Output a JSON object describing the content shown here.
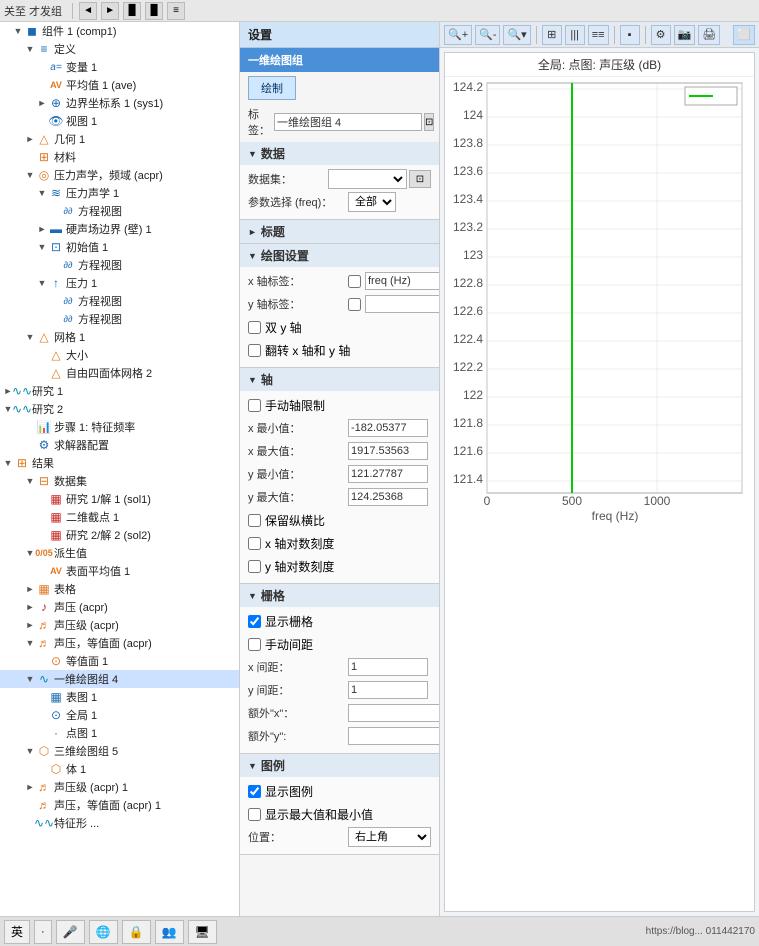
{
  "toolbar": {
    "label": "关至 才发组",
    "buttons": [
      "◄",
      "►",
      "▐▌",
      "▐▌",
      "≡"
    ]
  },
  "left_panel": {
    "tree_items": [
      {
        "id": "comp1",
        "label": "组件 1 (comp1)",
        "indent": 0,
        "arrow": "▼",
        "icon": "cube",
        "icon_color": "blue"
      },
      {
        "id": "defs",
        "label": "定义",
        "indent": 1,
        "arrow": "▼",
        "icon": "list",
        "icon_color": "blue"
      },
      {
        "id": "var1",
        "label": "变量 1",
        "indent": 2,
        "arrow": "",
        "icon": "a",
        "icon_color": "blue"
      },
      {
        "id": "ave",
        "label": "平均值 1 (ave)",
        "indent": 2,
        "arrow": "",
        "icon": "av",
        "icon_color": "orange"
      },
      {
        "id": "sys1",
        "label": "边界坐标系 1 (sys1)",
        "indent": 2,
        "arrow": "►",
        "icon": "axis",
        "icon_color": "blue"
      },
      {
        "id": "view1",
        "label": "视图 1",
        "indent": 2,
        "arrow": "",
        "icon": "eye",
        "icon_color": "blue"
      },
      {
        "id": "geo1",
        "label": "几何 1",
        "indent": 1,
        "arrow": "►",
        "icon": "triangle",
        "icon_color": "orange"
      },
      {
        "id": "mat",
        "label": "材料",
        "indent": 1,
        "arrow": "",
        "icon": "grid",
        "icon_color": "orange"
      },
      {
        "id": "acpr",
        "label": "压力声学，频域 (acpr)",
        "indent": 1,
        "arrow": "▼",
        "icon": "circle",
        "icon_color": "orange"
      },
      {
        "id": "pa1",
        "label": "压力声学 1",
        "indent": 2,
        "arrow": "▼",
        "icon": "wave",
        "icon_color": "blue"
      },
      {
        "id": "eqview1",
        "label": "方程视图",
        "indent": 3,
        "arrow": "",
        "icon": "eq",
        "icon_color": "blue"
      },
      {
        "id": "hb1",
        "label": "硬声场边界 (壁) 1",
        "indent": 2,
        "arrow": "►",
        "icon": "wall",
        "icon_color": "blue"
      },
      {
        "id": "init1",
        "label": "初始值 1",
        "indent": 2,
        "arrow": "▼",
        "icon": "init",
        "icon_color": "blue"
      },
      {
        "id": "eqview2",
        "label": "方程视图",
        "indent": 3,
        "arrow": "",
        "icon": "eq",
        "icon_color": "blue"
      },
      {
        "id": "p1",
        "label": "压力 1",
        "indent": 2,
        "arrow": "▼",
        "icon": "pressure",
        "icon_color": "blue"
      },
      {
        "id": "eqview3",
        "label": "方程视图",
        "indent": 3,
        "arrow": "",
        "icon": "eq",
        "icon_color": "blue"
      },
      {
        "id": "eqview4",
        "label": "方程视图",
        "indent": 3,
        "arrow": "",
        "icon": "eq",
        "icon_color": "blue"
      },
      {
        "id": "mesh1",
        "label": "网格 1",
        "indent": 1,
        "arrow": "▼",
        "icon": "mesh",
        "icon_color": "orange"
      },
      {
        "id": "size1",
        "label": "大小",
        "indent": 2,
        "arrow": "",
        "icon": "mesh-size",
        "icon_color": "orange"
      },
      {
        "id": "ftet2",
        "label": "自由四面体网格 2",
        "indent": 2,
        "arrow": "",
        "icon": "ftet",
        "icon_color": "orange"
      },
      {
        "id": "study1",
        "label": "研究 1",
        "indent": 0,
        "arrow": "►",
        "icon": "study",
        "icon_color": "teal"
      },
      {
        "id": "study2",
        "label": "研究 2",
        "indent": 0,
        "arrow": "▼",
        "icon": "study",
        "icon_color": "teal"
      },
      {
        "id": "step1",
        "label": "步骤 1: 特征频率",
        "indent": 1,
        "arrow": "",
        "icon": "chart-bar",
        "icon_color": "blue"
      },
      {
        "id": "solver1",
        "label": "求解器配置",
        "indent": 1,
        "arrow": "",
        "icon": "solver",
        "icon_color": "blue"
      },
      {
        "id": "results",
        "label": "结果",
        "indent": 0,
        "arrow": "▼",
        "icon": "results",
        "icon_color": "orange"
      },
      {
        "id": "datasets",
        "label": "数据集",
        "indent": 1,
        "arrow": "▼",
        "icon": "dataset",
        "icon_color": "orange"
      },
      {
        "id": "sol1",
        "label": "研究 1/解 1 (sol1)",
        "indent": 2,
        "arrow": "",
        "icon": "sol",
        "icon_color": "red"
      },
      {
        "id": "pts2d",
        "label": "二维截点 1",
        "indent": 2,
        "arrow": "",
        "icon": "pts",
        "icon_color": "red"
      },
      {
        "id": "sol2",
        "label": "研究 2/解 2 (sol2)",
        "indent": 2,
        "arrow": "",
        "icon": "sol",
        "icon_color": "red"
      },
      {
        "id": "derived",
        "label": "派生值",
        "indent": 1,
        "arrow": "▼",
        "icon": "derived",
        "icon_color": "orange"
      },
      {
        "id": "surfavg1",
        "label": "表面平均值 1",
        "indent": 2,
        "arrow": "",
        "icon": "av",
        "icon_color": "orange"
      },
      {
        "id": "tables",
        "label": "表格",
        "indent": 1,
        "arrow": "►",
        "icon": "table",
        "icon_color": "orange"
      },
      {
        "id": "sound",
        "label": "声压 (acpr)",
        "indent": 1,
        "arrow": "►",
        "icon": "sound",
        "icon_color": "red"
      },
      {
        "id": "spl",
        "label": "声压级 (acpr)",
        "indent": 1,
        "arrow": "►",
        "icon": "spl",
        "icon_color": "orange"
      },
      {
        "id": "p_iso",
        "label": "声压，等值面 (acpr)",
        "indent": 1,
        "arrow": "▼",
        "icon": "iso",
        "icon_color": "orange"
      },
      {
        "id": "iso1",
        "label": "等值面 1",
        "indent": 2,
        "arrow": "",
        "icon": "iso-item",
        "icon_color": "orange"
      },
      {
        "id": "plot1d_4",
        "label": "一维绘图组 4",
        "indent": 1,
        "arrow": "▼",
        "icon": "plot1d",
        "icon_color": "teal",
        "selected": true
      },
      {
        "id": "table1",
        "label": "表图 1",
        "indent": 2,
        "arrow": "",
        "icon": "table-chart",
        "icon_color": "blue"
      },
      {
        "id": "global1",
        "label": "全局 1",
        "indent": 2,
        "arrow": "",
        "icon": "global",
        "icon_color": "blue"
      },
      {
        "id": "point1",
        "label": "点图 1",
        "indent": 2,
        "arrow": "",
        "icon": "point",
        "icon_color": "blue"
      },
      {
        "id": "plot3d_5",
        "label": "三维绘图组 5",
        "indent": 1,
        "arrow": "▼",
        "icon": "plot3d",
        "icon_color": "orange"
      },
      {
        "id": "body1",
        "label": "体 1",
        "indent": 2,
        "arrow": "",
        "icon": "body",
        "icon_color": "orange"
      },
      {
        "id": "spl2",
        "label": "声压级 (acpr) 1",
        "indent": 1,
        "arrow": "►",
        "icon": "spl",
        "icon_color": "orange"
      },
      {
        "id": "p_iso2",
        "label": "声压，等值面 (acpr) 1",
        "indent": 1,
        "arrow": "",
        "icon": "iso",
        "icon_color": "orange"
      },
      {
        "id": "study3",
        "label": "特征形 ...",
        "indent": 1,
        "arrow": "",
        "icon": "study",
        "icon_color": "teal"
      }
    ]
  },
  "mid_panel": {
    "header": "设置",
    "sub_header": "一维绘图组",
    "draw_btn": "绘制",
    "tag_label": "标签：",
    "tag_value": "一维绘图组 4",
    "sections": {
      "data": {
        "title": "数据",
        "dataset_label": "数据集：",
        "dataset_value": "",
        "param_label": "参数选择 (freq)：",
        "param_value": "全部"
      },
      "title_sec": {
        "title": "标题"
      },
      "plot_settings": {
        "title": "绘图设置",
        "x_axis_label": "x 轴标签：",
        "x_axis_checked": false,
        "x_axis_value": "freq (Hz)",
        "y_axis_label": "y 轴标签：",
        "y_axis_checked": false,
        "dual_y": "双 y 轴",
        "dual_y_checked": false,
        "flip_xy": "翻转 x 轴和 y 轴",
        "flip_xy_checked": false
      },
      "axis": {
        "title": "轴",
        "manual_limit": "手动轴限制",
        "manual_checked": false,
        "x_min_label": "x 最小值：",
        "x_min_value": "-182.05377",
        "x_max_label": "x 最大值：",
        "x_max_value": "1917.53563",
        "y_min_label": "y 最小值：",
        "y_min_value": "121.27787",
        "y_max_label": "y 最大值：",
        "y_max_value": "124.25368"
      },
      "preserve": {
        "keep_ratio": "保留纵横比",
        "keep_ratio_checked": false,
        "x_log": "x 轴对数刻度",
        "x_log_checked": false,
        "y_log": "y 轴对数刻度",
        "y_log_checked": false
      },
      "grid": {
        "title": "栅格",
        "show_grid": "显示栅格",
        "show_grid_checked": true,
        "manual_spacing": "手动间距",
        "manual_spacing_checked": false,
        "x_spacing_label": "x 间距：",
        "x_spacing_value": "1",
        "y_spacing_label": "y 间距：",
        "y_spacing_value": "1",
        "extra_x_label": "额外\"x\"：",
        "extra_y_label": "额外\"y\":"
      },
      "legend": {
        "title": "图例",
        "show_legend": "显示图例",
        "show_legend_checked": true,
        "show_minmax": "显示最大值和最小值",
        "show_minmax_checked": false,
        "pos_label": "位置：",
        "pos_value": "右上角"
      }
    }
  },
  "right_panel": {
    "chart_title": "全局: 点图: 声压级 (dB)",
    "toolbar_btns": [
      "🔍+",
      "🔍-",
      "🔍▾",
      "⊞",
      "|||",
      "≡≡",
      "▪",
      "⚙",
      "📷",
      "🖨"
    ],
    "y_labels": [
      "124.2",
      "124",
      "123.8",
      "123.6",
      "123.4",
      "123.2",
      "123",
      "122.8",
      "122.6",
      "122.4",
      "122.2",
      "122",
      "121.8",
      "121.6",
      "121.4"
    ],
    "x_labels": [
      "0",
      "500",
      "1000"
    ],
    "x_axis_label": "freq (Hz)",
    "spike_x_position": 0.45,
    "spike_y_bottom": 0.05,
    "spike_y_top": 0.55
  },
  "bottom_bar": {
    "items": [
      "英",
      "·",
      "🎤",
      "🌐",
      "🔒",
      "👥",
      "🖥"
    ]
  }
}
